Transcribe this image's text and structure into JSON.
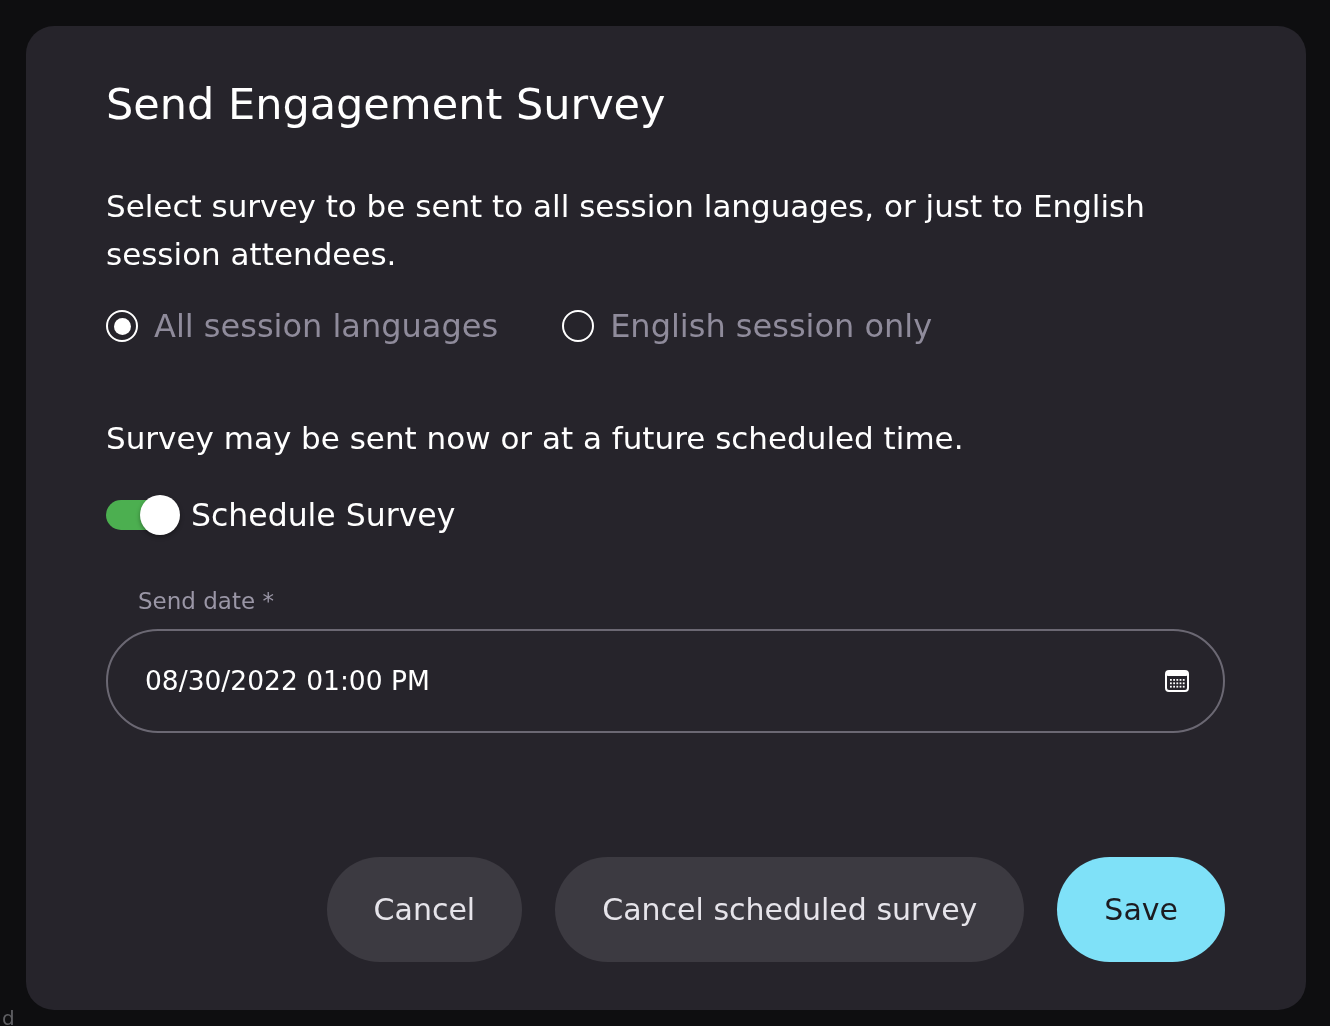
{
  "dialog": {
    "title": "Send Engagement Survey",
    "description": "Select survey to be sent to all session languages, or just to English session attendees.",
    "language_options": [
      {
        "label": "All session languages",
        "selected": true
      },
      {
        "label": "English session only",
        "selected": false
      }
    ],
    "schedule_note": "Survey may be sent now or at a future scheduled time.",
    "schedule_toggle": {
      "label": "Schedule Survey",
      "on": true
    },
    "send_date": {
      "label": "Send date *",
      "value": "08/30/2022 01:00 PM"
    },
    "buttons": [
      {
        "label": "Cancel",
        "kind": "secondary"
      },
      {
        "label": "Cancel scheduled survey",
        "kind": "secondary"
      },
      {
        "label": "Save",
        "kind": "primary"
      }
    ]
  },
  "backdrop": {
    "text_fragment": "d"
  }
}
